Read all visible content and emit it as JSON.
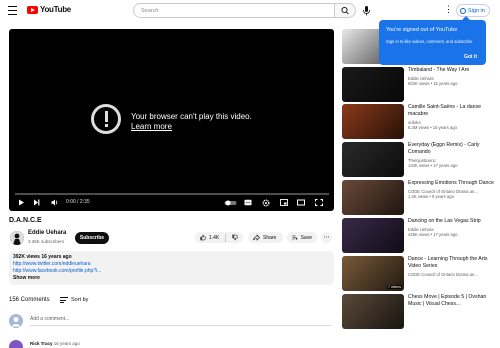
{
  "header": {
    "logo_text": "YouTube",
    "search_placeholder": "Search",
    "signin_label": "Sign in"
  },
  "player": {
    "error_line1": "Your browser can't play this video.",
    "error_link": "Learn more",
    "time": "0:00 / 2:35"
  },
  "video": {
    "title": "D.A.N.C.E",
    "channel": "Eddie Uehara",
    "subscribers": "3.36K subscribers",
    "subscribe_label": "Subscribe",
    "likes": "1.4K",
    "share_label": "Share",
    "save_label": "Save",
    "views_date": "392K views  16 years ago",
    "link1": "http://www.twitter.com/eddieuehara",
    "link2": "http://www.facebook.com/profile.php?i...",
    "show_more": "Show more"
  },
  "comments": {
    "count": "156 Comments",
    "sort_label": "Sort by",
    "add_placeholder": "Add a comment...",
    "first_author": "Rick Tracy",
    "first_age": "16 years ago"
  },
  "popup": {
    "title": "You're signed out of YouTube",
    "body": "Sign in to like videos, comment, and subscribe.",
    "ok": "Got it"
  },
  "recommendations": [
    {
      "title": "Dance Book by Eddie Uehara",
      "channel": "Eddie Uehara",
      "meta": "134K views • 14 years ago",
      "thumb_color": "#e8e8e8"
    },
    {
      "title": "Timbaland - The Way I Are",
      "channel": "Eddie Uehara",
      "meta": "603K views • 15 years ago",
      "thumb_color": "#1a1a1a"
    },
    {
      "title": "Camille Saint-Saëns - La danse macabre",
      "channel": "ordoko",
      "meta": "6.3M views • 15 years ago",
      "thumb_color": "#8a3a1a"
    },
    {
      "title": "Everyday (Eggo Remix) - Carly Comando",
      "channel": "Theinjusticeinc",
      "meta": "134K views • 17 years ago",
      "thumb_color": "#2a2a2a"
    },
    {
      "title": "Expressing Emotions Through Dance",
      "channel": "CODE Council of Ontario Drama an...",
      "meta": "1.4K views • 8 years ago",
      "thumb_color": "#6b4a3a"
    },
    {
      "title": "Dancing on the Las Vegas Strip",
      "channel": "Eddie Uehara",
      "meta": "425K views • 17 years ago",
      "thumb_color": "#3a2a4a"
    },
    {
      "title": "Dance - Learning Through the Arts Video Series",
      "channel": "CODE Council of Ontario Drama an...",
      "meta": "",
      "thumb_color": "#7a5a3a",
      "duration": "7 videos"
    },
    {
      "title": "Chess Move | Episode 5 | Ovshan Music | Visual Chess...",
      "channel": "",
      "meta": "",
      "thumb_color": "#5a4a3a"
    }
  ]
}
